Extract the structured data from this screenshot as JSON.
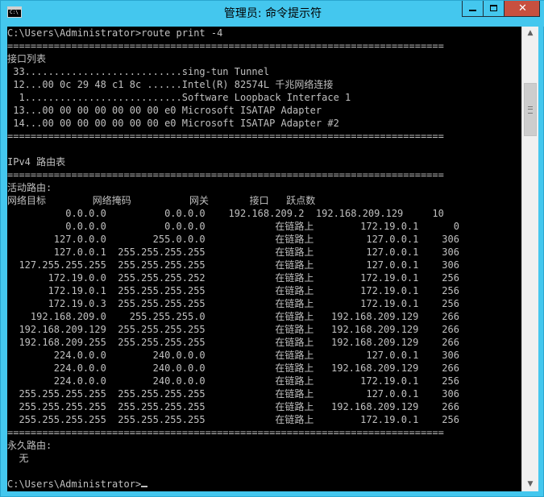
{
  "window": {
    "title": "管理员: 命令提示符",
    "icon": "cmd-icon",
    "icon_text": "C:\\",
    "buttons": {
      "minimize": "minimize-icon",
      "maximize": "maximize-icon",
      "close": "close-icon",
      "close_glyph": "✕"
    }
  },
  "scrollbar": {
    "up_glyph": "▲",
    "down_glyph": "▼"
  },
  "console": {
    "lines": [
      "C:\\Users\\Administrator>route print -4",
      "===========================================================================",
      "接口列表",
      " 33...........................sing-tun Tunnel",
      " 12...00 0c 29 48 c1 8c ......Intel(R) 82574L 千兆网络连接",
      "  1...........................Software Loopback Interface 1",
      " 13...00 00 00 00 00 00 00 e0 Microsoft ISATAP Adapter",
      " 14...00 00 00 00 00 00 00 e0 Microsoft ISATAP Adapter #2",
      "===========================================================================",
      "",
      "IPv4 路由表",
      "===========================================================================",
      "活动路由:",
      "网络目标        网络掩码          网关       接口   跃点数",
      "          0.0.0.0          0.0.0.0    192.168.209.2  192.168.209.129     10",
      "          0.0.0.0          0.0.0.0            在链路上        172.19.0.1      0",
      "        127.0.0.0        255.0.0.0            在链路上         127.0.0.1    306",
      "        127.0.0.1  255.255.255.255            在链路上         127.0.0.1    306",
      "  127.255.255.255  255.255.255.255            在链路上         127.0.0.1    306",
      "       172.19.0.0  255.255.255.252            在链路上        172.19.0.1    256",
      "       172.19.0.1  255.255.255.255            在链路上        172.19.0.1    256",
      "       172.19.0.3  255.255.255.255            在链路上        172.19.0.1    256",
      "    192.168.209.0    255.255.255.0            在链路上   192.168.209.129    266",
      "  192.168.209.129  255.255.255.255            在链路上   192.168.209.129    266",
      "  192.168.209.255  255.255.255.255            在链路上   192.168.209.129    266",
      "        224.0.0.0        240.0.0.0            在链路上         127.0.0.1    306",
      "        224.0.0.0        240.0.0.0            在链路上   192.168.209.129    266",
      "        224.0.0.0        240.0.0.0            在链路上        172.19.0.1    256",
      "  255.255.255.255  255.255.255.255            在链路上         127.0.0.1    306",
      "  255.255.255.255  255.255.255.255            在链路上   192.168.209.129    266",
      "  255.255.255.255  255.255.255.255            在链路上        172.19.0.1    256",
      "===========================================================================",
      "永久路由:",
      "  无",
      "",
      "C:\\Users\\Administrator>"
    ]
  },
  "colors": {
    "titlebar": "#44c7ee",
    "console_bg": "#000000",
    "console_fg": "#c0c0c0",
    "close_button": "#c7503f"
  }
}
